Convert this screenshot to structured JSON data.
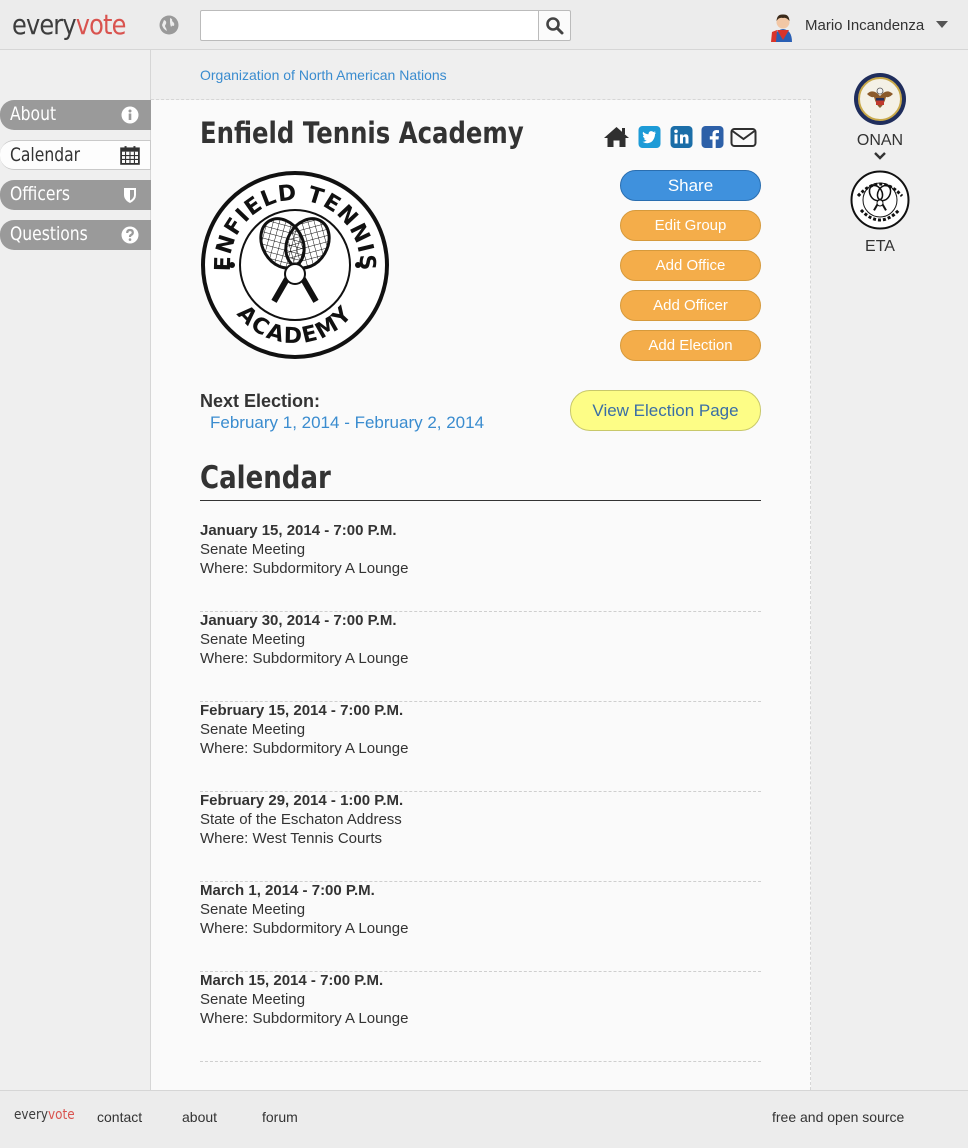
{
  "header": {
    "logo_a": "every",
    "logo_b": "vote",
    "search_placeholder": "",
    "user_name": "Mario Incandenza"
  },
  "sidebar": {
    "items": [
      {
        "label": "About",
        "icon": "info-icon"
      },
      {
        "label": "Calendar",
        "icon": "calendar-icon"
      },
      {
        "label": "Officers",
        "icon": "shield-icon"
      },
      {
        "label": "Questions",
        "icon": "question-icon"
      }
    ],
    "active": "Calendar"
  },
  "breadcrumb": {
    "parent": "Organization of North American Nations"
  },
  "group": {
    "title": "Enfield Tennis Academy",
    "social_icons": [
      "home-icon",
      "twitter-icon",
      "linkedin-icon",
      "facebook-icon",
      "envelope-icon"
    ]
  },
  "actions": {
    "share": "Share",
    "edit_group": "Edit Group",
    "add_office": "Add Office",
    "add_officer": "Add Officer",
    "add_election": "Add Election"
  },
  "election": {
    "label": "Next Election:",
    "dates": "February 1, 2014 - February 2, 2014",
    "view_button": "View Election Page"
  },
  "calendar": {
    "title": "Calendar",
    "events": [
      {
        "date": "January 15, 2014 - 7:00 P.M.",
        "title": "Senate Meeting",
        "where": "Where: Subdormitory A Lounge"
      },
      {
        "date": "January 30, 2014 - 7:00 P.M.",
        "title": "Senate Meeting",
        "where": "Where: Subdormitory A Lounge"
      },
      {
        "date": "February 15, 2014 - 7:00 P.M.",
        "title": "Senate Meeting",
        "where": "Where: Subdormitory A Lounge"
      },
      {
        "date": "February 29, 2014 - 1:00 P.M.",
        "title": "State of the Eschaton Address",
        "where": "Where: West Tennis Courts"
      },
      {
        "date": "March 1, 2014 - 7:00 P.M.",
        "title": "Senate Meeting",
        "where": "Where: Subdormitory A Lounge"
      },
      {
        "date": "March 15, 2014 - 7:00 P.M.",
        "title": "Senate Meeting",
        "where": "Where: Subdormitory A Lounge"
      }
    ]
  },
  "right_sidebar": {
    "parent_abbr": "ONAN",
    "group_abbr": "ETA"
  },
  "footer": {
    "logo_a": "every",
    "logo_b": "vote",
    "links": [
      "contact",
      "about",
      "forum"
    ],
    "right_text": "free and open source"
  },
  "colors": {
    "link": "#3a8ccf",
    "brand_red": "#d9534f",
    "orange_button": "#f4ad4a",
    "share_blue": "#3f91dd",
    "yellow_button": "#fdfd86"
  }
}
